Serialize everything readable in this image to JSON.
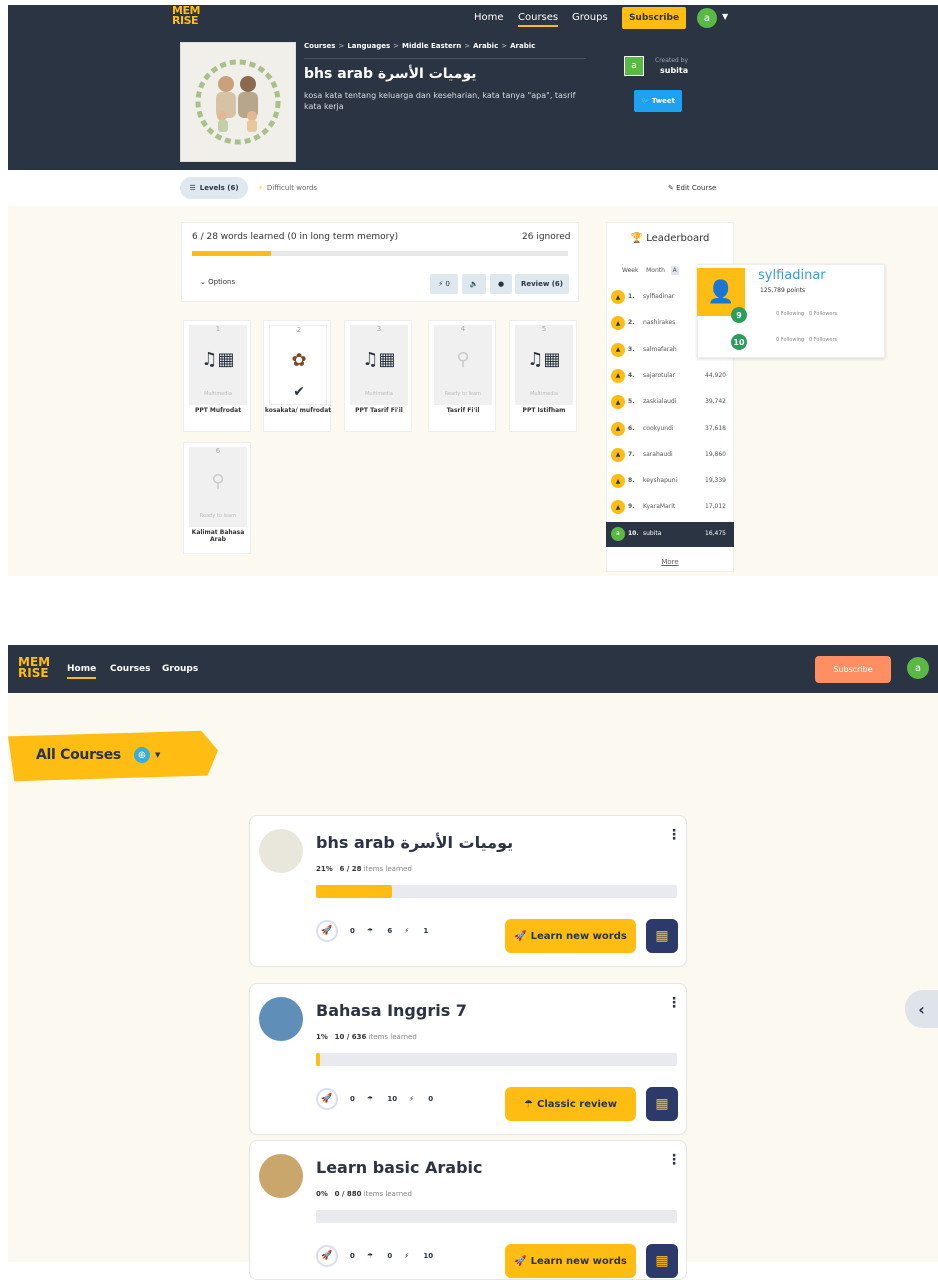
{
  "top": {
    "logo_line1": "MEM",
    "logo_line2": "RISE",
    "nav": {
      "home": "Home",
      "courses": "Courses",
      "groups": "Groups"
    },
    "subscribe": "Subscribe",
    "avatar_letter": "a",
    "breadcrumb": [
      "Courses",
      "Languages",
      "Middle Eastern",
      "Arabic",
      "Arabic"
    ],
    "breadcrumb_sep": ">",
    "course_title": "bhs arab يوميات الأسرة",
    "course_description": "kosa kata tentang keluarga dan keseharian, kata tanya \"apa\", tasrif kata kerja",
    "created_by_label": "Created by",
    "creator_name": "subita",
    "creator_avatar": "a",
    "tweet": "Tweet",
    "levels_tab": "Levels (6)",
    "difficult_words": "Difficult words",
    "edit_course": "Edit Course",
    "words_learned": "6 / 28 words learned (0 in long term memory)",
    "ignored": "26 ignored",
    "progress": 0.21,
    "options": "Options",
    "stat_bolt": "0",
    "review": "Review (6)",
    "levels": [
      {
        "num": "1",
        "icon": "multimedia-icon",
        "sub": "Multimedia",
        "name": "PPT Mufrodat"
      },
      {
        "num": "2",
        "icon": "flower-icon",
        "sub": "",
        "name": "kosakata/ mufrodat"
      },
      {
        "num": "3",
        "icon": "multimedia-icon",
        "sub": "Multimedia",
        "name": "PPT Tasrif Fi'il"
      },
      {
        "num": "4",
        "icon": "seed-icon",
        "sub": "Ready to learn",
        "name": "Tasrif Fi'il"
      },
      {
        "num": "5",
        "icon": "multimedia-icon",
        "sub": "Multimedia",
        "name": "PPT Istifham"
      },
      {
        "num": "6",
        "icon": "seed-icon",
        "sub": "Ready to learn",
        "name": "Kalimat Bahasa Arab"
      }
    ],
    "leaderboard": {
      "title": "Leaderboard",
      "tabs": [
        "Week",
        "Month",
        "A"
      ],
      "rows": [
        {
          "rank": "1.",
          "name": "sylfiadinar",
          "points": ""
        },
        {
          "rank": "2.",
          "name": "nashirakes",
          "points": ""
        },
        {
          "rank": "3.",
          "name": "salmafarah",
          "points": ""
        },
        {
          "rank": "4.",
          "name": "sajarotular",
          "points": "44,920"
        },
        {
          "rank": "5.",
          "name": "zaskialaudi",
          "points": "39,742"
        },
        {
          "rank": "6.",
          "name": "cookyundi",
          "points": "37,618"
        },
        {
          "rank": "7.",
          "name": "sarahaudi",
          "points": "19,860"
        },
        {
          "rank": "8.",
          "name": "keyshapuni",
          "points": "19,339"
        },
        {
          "rank": "9.",
          "name": "KyaraMarit",
          "points": "17,012"
        },
        {
          "rank": "10.",
          "name": "subita",
          "points": "16,475"
        }
      ],
      "more": "More"
    },
    "popup": {
      "name": "sylfiadinar",
      "points": "125,789 points",
      "following": "0 Following",
      "followers": "0 Followers",
      "level1": "9",
      "level2": "10"
    }
  },
  "bottom": {
    "logo_line1": "MEM",
    "logo_line2": "RISE",
    "nav": {
      "home": "Home",
      "courses": "Courses",
      "groups": "Groups"
    },
    "subscribe": "Subscribe",
    "avatar_letter": "a",
    "all_courses": "All Courses",
    "courses": [
      {
        "title": "bhs arab يوميات الأسرة",
        "percent": "21%",
        "items": "6 / 28",
        "items_label": "items learned",
        "progress": 0.21,
        "s1": "0",
        "s2": "6",
        "s3": "1",
        "button": "Learn new words"
      },
      {
        "title": "Bahasa Inggris 7",
        "percent": "1%",
        "items": "10 / 636",
        "items_label": "items learned",
        "progress": 0.01,
        "s1": "0",
        "s2": "10",
        "s3": "0",
        "button": "Classic review"
      },
      {
        "title": "Learn basic Arabic",
        "percent": "0%",
        "items": "0 / 880",
        "items_label": "items learned",
        "progress": 0.0,
        "s1": "0",
        "s2": "0",
        "s3": "10",
        "button": "Learn new words"
      }
    ]
  },
  "colors": {
    "navy": "#2b3442",
    "accent": "#ffbd14",
    "green": "#5ab845",
    "subscribe_bottom": "#ff8f63"
  }
}
